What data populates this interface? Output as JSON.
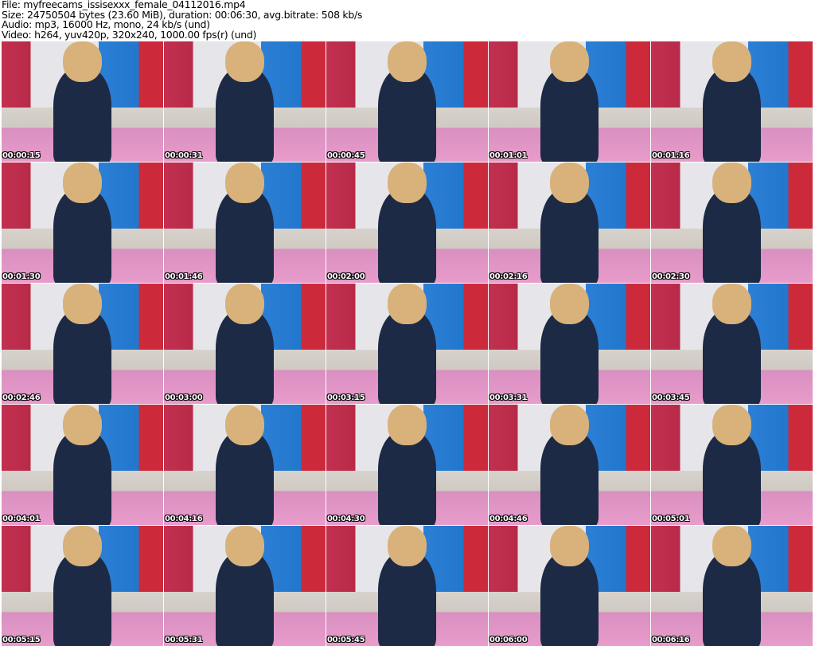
{
  "header": {
    "file": "File: myfreecams_issisexxx_female_04112016.mp4",
    "size": "Size: 24750504 bytes (23.60 MiB), duration: 00:06:30, avg.bitrate: 508 kb/s",
    "audio": "Audio: mp3, 16000 Hz, mono, 24 kb/s (und)",
    "video": "Video: h264, yuv420p, 320x240, 1000.00 fps(r) (und)"
  },
  "thumbnails": [
    {
      "timestamp": "00:00:15"
    },
    {
      "timestamp": "00:00:31"
    },
    {
      "timestamp": "00:00:45"
    },
    {
      "timestamp": "00:01:01"
    },
    {
      "timestamp": "00:01:16"
    },
    {
      "timestamp": "00:01:30"
    },
    {
      "timestamp": "00:01:46"
    },
    {
      "timestamp": "00:02:00"
    },
    {
      "timestamp": "00:02:16"
    },
    {
      "timestamp": "00:02:30"
    },
    {
      "timestamp": "00:02:46"
    },
    {
      "timestamp": "00:03:00"
    },
    {
      "timestamp": "00:03:15"
    },
    {
      "timestamp": "00:03:31"
    },
    {
      "timestamp": "00:03:45"
    },
    {
      "timestamp": "00:04:01"
    },
    {
      "timestamp": "00:04:16"
    },
    {
      "timestamp": "00:04:30"
    },
    {
      "timestamp": "00:04:46"
    },
    {
      "timestamp": "00:05:01"
    },
    {
      "timestamp": "00:05:15"
    },
    {
      "timestamp": "00:05:31"
    },
    {
      "timestamp": "00:05:45"
    },
    {
      "timestamp": "00:06:00"
    },
    {
      "timestamp": "00:06:16"
    }
  ]
}
